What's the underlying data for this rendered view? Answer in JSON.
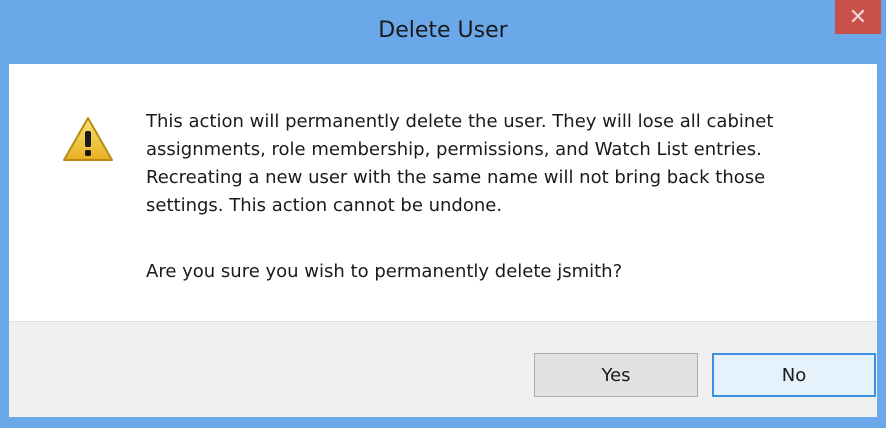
{
  "dialog": {
    "title": "Delete User",
    "close_glyph": "✕",
    "icon": "warning-icon",
    "message": "This action will permanently delete the user. They will lose all cabinet assignments, role membership, permissions, and Watch List entries. Recreating a new user with the same name will not bring back those settings. This action cannot be undone.",
    "question": "Are you sure you wish to permanently delete jsmith?",
    "buttons": {
      "yes_label": "Yes",
      "no_label": "No"
    }
  },
  "colors": {
    "frame": "#6aa8ea",
    "close_button": "#c7504b",
    "footer": "#f0f0f0",
    "focus_border": "#3c90e0"
  }
}
